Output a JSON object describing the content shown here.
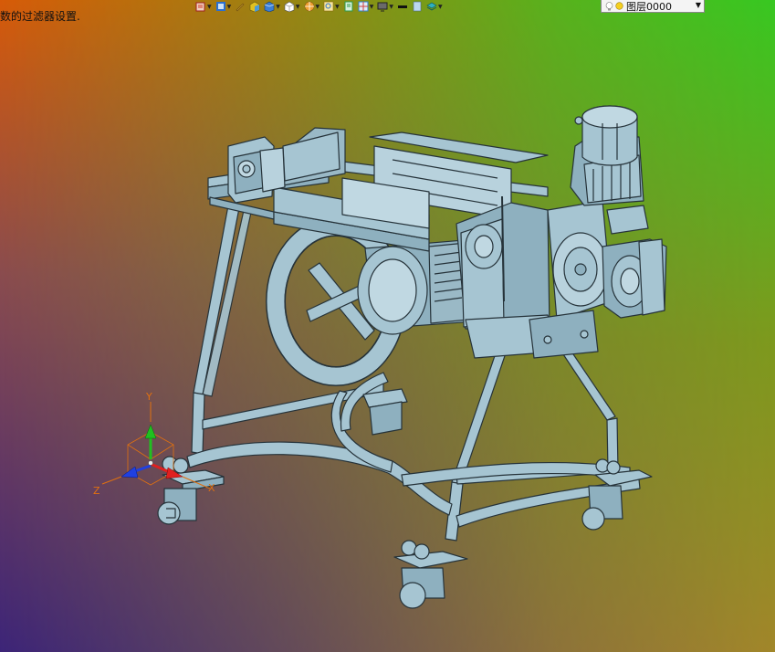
{
  "status": {
    "text": "数的过滤器设置."
  },
  "toolbar": {
    "icons": [
      {
        "name": "select-icon",
        "color": "#d23a2a"
      },
      {
        "name": "view-icon",
        "color": "#2b6fd0"
      },
      {
        "name": "pencil-icon",
        "color": "#c99a2a"
      },
      {
        "name": "solid-shade-icon",
        "color": "#e0c020"
      },
      {
        "name": "cube-icon",
        "color": "#3c7fd6"
      },
      {
        "name": "white-cube-icon",
        "color": "#ffffff"
      },
      {
        "name": "color-wheel-icon",
        "color": "#f0a030"
      },
      {
        "name": "magnify-icon",
        "color": "#e8c040"
      },
      {
        "name": "page-icon",
        "color": "#2e9a4a"
      },
      {
        "name": "grid-icon",
        "color": "#2e7fcf"
      },
      {
        "name": "monitor-icon",
        "color": "#4a4a4a"
      },
      {
        "name": "black-bar-icon",
        "color": "#111111"
      },
      {
        "name": "blank-page-icon",
        "color": "#bcd8f0"
      },
      {
        "name": "layer-stack-icon",
        "color": "#2fb0c0"
      }
    ]
  },
  "layer": {
    "label": "图层0000"
  },
  "triad": {
    "x_label": "X",
    "y_label": "Y",
    "z_label": "Z"
  },
  "colors": {
    "part": "#a6c5d2",
    "edge": "#26333a",
    "x_axis": "#e02020",
    "y_axis": "#20c020",
    "z_axis": "#2040e0",
    "label": "#e07010"
  }
}
